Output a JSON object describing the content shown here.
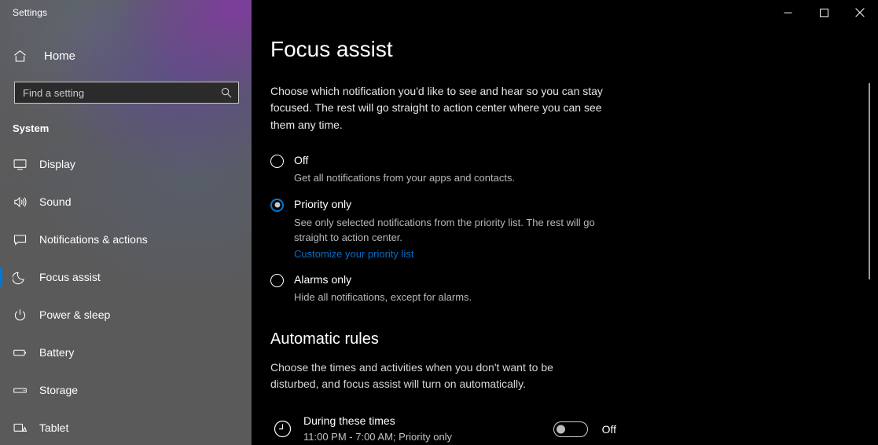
{
  "window": {
    "app_title": "Settings",
    "controls": [
      {
        "name": "minimize",
        "label": "Minimize"
      },
      {
        "name": "maximize",
        "label": "Maximize"
      },
      {
        "name": "close",
        "label": "Close"
      }
    ]
  },
  "sidebar": {
    "home_label": "Home",
    "home_icon": "home-icon",
    "search": {
      "placeholder": "Find a setting",
      "value": "",
      "icon": "search-icon"
    },
    "section_label": "System",
    "items": [
      {
        "label": "Display",
        "icon": "monitor-icon",
        "selected": false
      },
      {
        "label": "Sound",
        "icon": "speaker-icon",
        "selected": false
      },
      {
        "label": "Notifications & actions",
        "icon": "notification-icon",
        "selected": false
      },
      {
        "label": "Focus assist",
        "icon": "moon-icon",
        "selected": true
      },
      {
        "label": "Power & sleep",
        "icon": "power-icon",
        "selected": false
      },
      {
        "label": "Battery",
        "icon": "battery-icon",
        "selected": false
      },
      {
        "label": "Storage",
        "icon": "storage-icon",
        "selected": false
      },
      {
        "label": "Tablet",
        "icon": "tablet-icon",
        "selected": false
      }
    ]
  },
  "main": {
    "page_title": "Focus assist",
    "page_description": "Choose which notification you'd like to see and hear so you can stay focused. The rest will go straight to action center where you can see them any time.",
    "radio_options": [
      {
        "label": "Off",
        "description": "Get all notifications from your apps and contacts.",
        "selected": false,
        "link": null
      },
      {
        "label": "Priority only",
        "description": "See only selected notifications from the priority list. The rest will go straight to action center.",
        "selected": true,
        "link": "Customize your priority list"
      },
      {
        "label": "Alarms only",
        "description": "Hide all notifications, except for alarms.",
        "selected": false,
        "link": null
      }
    ],
    "automatic_rules": {
      "heading": "Automatic rules",
      "description": "Choose the times and activities when you don't want to be disturbed, and focus assist will turn on automatically.",
      "rules": [
        {
          "icon": "clock-icon",
          "title": "During these times",
          "meta": "11:00 PM - 7:00 AM; Priority only",
          "toggle_state": "Off",
          "toggle_on": false
        }
      ]
    }
  },
  "colors": {
    "accent": "#0078d7",
    "link": "#0a6cc4",
    "sidebar_base": "#5a5a5a",
    "content_background": "#000000"
  }
}
